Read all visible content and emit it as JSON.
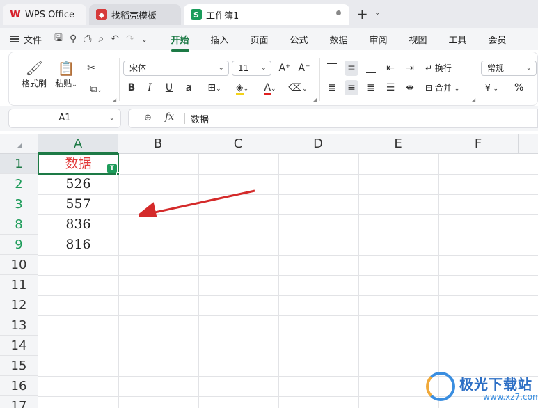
{
  "tabs": [
    {
      "label": "WPS Office"
    },
    {
      "label": "找稻壳模板"
    },
    {
      "label": "工作簿1"
    }
  ],
  "menu": {
    "file": "文件",
    "ribbon_tabs": [
      "开始",
      "插入",
      "页面",
      "公式",
      "数据",
      "审阅",
      "视图",
      "工具",
      "会员"
    ],
    "active_tab": "开始"
  },
  "ribbon": {
    "format_painter": "格式刷",
    "paste": "粘贴",
    "font_name": "宋体",
    "font_size": "11",
    "wrap": "换行",
    "merge": "合并",
    "number_format": "常规",
    "currency": "¥",
    "percent": "%"
  },
  "formula_bar": {
    "name_box": "A1",
    "fx": "fx",
    "value": "数据"
  },
  "columns": [
    "A",
    "B",
    "C",
    "D",
    "E",
    "F"
  ],
  "rows": [
    "1",
    "2",
    "3",
    "8",
    "9",
    "10",
    "11",
    "12",
    "13",
    "14",
    "15",
    "16",
    "17"
  ],
  "cells": [
    "数据",
    "526",
    "557",
    "836",
    "816"
  ],
  "badge": "T",
  "watermark": {
    "title": "极光下载站",
    "url": "www.xz7.com"
  },
  "colors": {
    "accent": "#1d7a46",
    "header_text": "#e23b3b",
    "arrow": "#d42a2a"
  }
}
